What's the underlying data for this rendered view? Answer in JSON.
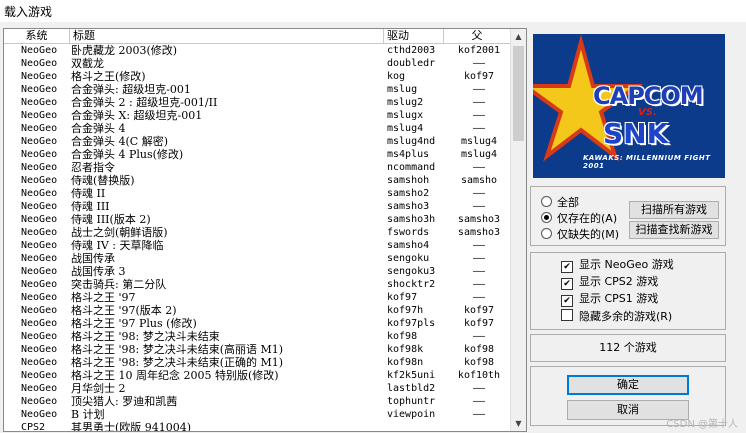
{
  "window": {
    "title": "载入游戏"
  },
  "list": {
    "columns": {
      "system": "系统",
      "title": "标题",
      "driver": "驱动",
      "parent": "父"
    },
    "rows": [
      {
        "system": "NeoGeo",
        "title": "卧虎藏龙 2003(修改)",
        "driver": "cthd2003",
        "parent": "kof2001"
      },
      {
        "system": "NeoGeo",
        "title": "双截龙",
        "driver": "doubledr",
        "parent": "——"
      },
      {
        "system": "NeoGeo",
        "title": "格斗之王(修改)",
        "driver": "kog",
        "parent": "kof97"
      },
      {
        "system": "NeoGeo",
        "title": "合金弹头: 超级坦克-001",
        "driver": "mslug",
        "parent": "——"
      },
      {
        "system": "NeoGeo",
        "title": "合金弹头 2 : 超级坦克-001/II",
        "driver": "mslug2",
        "parent": "——"
      },
      {
        "system": "NeoGeo",
        "title": "合金弹头 X: 超级坦克-001",
        "driver": "mslugx",
        "parent": "——"
      },
      {
        "system": "NeoGeo",
        "title": "合金弹头 4",
        "driver": "mslug4",
        "parent": "——"
      },
      {
        "system": "NeoGeo",
        "title": "合金弹头 4(C 解密)",
        "driver": "mslug4nd",
        "parent": "mslug4"
      },
      {
        "system": "NeoGeo",
        "title": "合金弹头 4 Plus(修改)",
        "driver": "ms4plus",
        "parent": "mslug4"
      },
      {
        "system": "NeoGeo",
        "title": "忍者指令",
        "driver": "ncommand",
        "parent": "——"
      },
      {
        "system": "NeoGeo",
        "title": "侍魂(替换版)",
        "driver": "samshoh",
        "parent": "samsho"
      },
      {
        "system": "NeoGeo",
        "title": "侍魂 II",
        "driver": "samsho2",
        "parent": "——"
      },
      {
        "system": "NeoGeo",
        "title": "侍魂 III",
        "driver": "samsho3",
        "parent": "——"
      },
      {
        "system": "NeoGeo",
        "title": "侍魂 III(版本 2)",
        "driver": "samsho3h",
        "parent": "samsho3"
      },
      {
        "system": "NeoGeo",
        "title": "战士之剑(朝鲜语版)",
        "driver": "fswords",
        "parent": "samsho3"
      },
      {
        "system": "NeoGeo",
        "title": "侍魂 IV : 天草降临",
        "driver": "samsho4",
        "parent": "——"
      },
      {
        "system": "NeoGeo",
        "title": "战国传承",
        "driver": "sengoku",
        "parent": "——"
      },
      {
        "system": "NeoGeo",
        "title": "战国传承 3",
        "driver": "sengoku3",
        "parent": "——"
      },
      {
        "system": "NeoGeo",
        "title": "突击骑兵: 第二分队",
        "driver": "shocktr2",
        "parent": "——"
      },
      {
        "system": "NeoGeo",
        "title": "格斗之王 '97",
        "driver": "kof97",
        "parent": "——"
      },
      {
        "system": "NeoGeo",
        "title": "格斗之王 '97(版本 2)",
        "driver": "kof97h",
        "parent": "kof97"
      },
      {
        "system": "NeoGeo",
        "title": "格斗之王 '97 Plus (修改)",
        "driver": "kof97pls",
        "parent": "kof97"
      },
      {
        "system": "NeoGeo",
        "title": "格斗之王 '98: 梦之决斗未结束",
        "driver": "kof98",
        "parent": "——"
      },
      {
        "system": "NeoGeo",
        "title": "格斗之王 '98: 梦之决斗未结束(高丽语 M1)",
        "driver": "kof98k",
        "parent": "kof98"
      },
      {
        "system": "NeoGeo",
        "title": "格斗之王 '98: 梦之决斗未结束(正确的 M1)",
        "driver": "kof98n",
        "parent": "kof98"
      },
      {
        "system": "NeoGeo",
        "title": "格斗之王 10 周年纪念 2005 特别版(修改)",
        "driver": "kf2k5uni",
        "parent": "kof10th"
      },
      {
        "system": "NeoGeo",
        "title": "月华剑士 2",
        "driver": "lastbld2",
        "parent": "——"
      },
      {
        "system": "NeoGeo",
        "title": "顶尖猎人: 罗迪和凯茜",
        "driver": "tophuntr",
        "parent": "——"
      },
      {
        "system": "NeoGeo",
        "title": "B 计划",
        "driver": "viewpoin",
        "parent": "——"
      },
      {
        "system": "CPS2",
        "title": "其男勇士(欧版 941004)",
        "driver": "",
        "parent": ""
      }
    ]
  },
  "preview": {
    "capcom": "CAPCOM",
    "vs": "VS.",
    "snk": "SNK",
    "subtitle": "KAWAKS: MILLENNIUM FIGHT 2001",
    "colors": {
      "background": "#0d3b8c",
      "star": "#f3c81a",
      "star_outline": "#d83a18"
    }
  },
  "filter": {
    "options": [
      {
        "label": "全部",
        "selected": false
      },
      {
        "label": "仅存在的(A)",
        "selected": true
      },
      {
        "label": "仅缺失的(M)",
        "selected": false
      }
    ],
    "scan_all": "扫描所有游戏",
    "scan_new": "扫描查找新游戏"
  },
  "display": {
    "options": [
      {
        "label": "显示 NeoGeo 游戏",
        "checked": true
      },
      {
        "label": "显示 CPS2 游戏",
        "checked": true
      },
      {
        "label": "显示 CPS1 游戏",
        "checked": true
      },
      {
        "label": "隐藏多余的游戏(R)",
        "checked": false
      }
    ]
  },
  "count_label": "112 个游戏",
  "buttons": {
    "ok": "确定",
    "cancel": "取消"
  },
  "watermark": "CSDN @第十人"
}
